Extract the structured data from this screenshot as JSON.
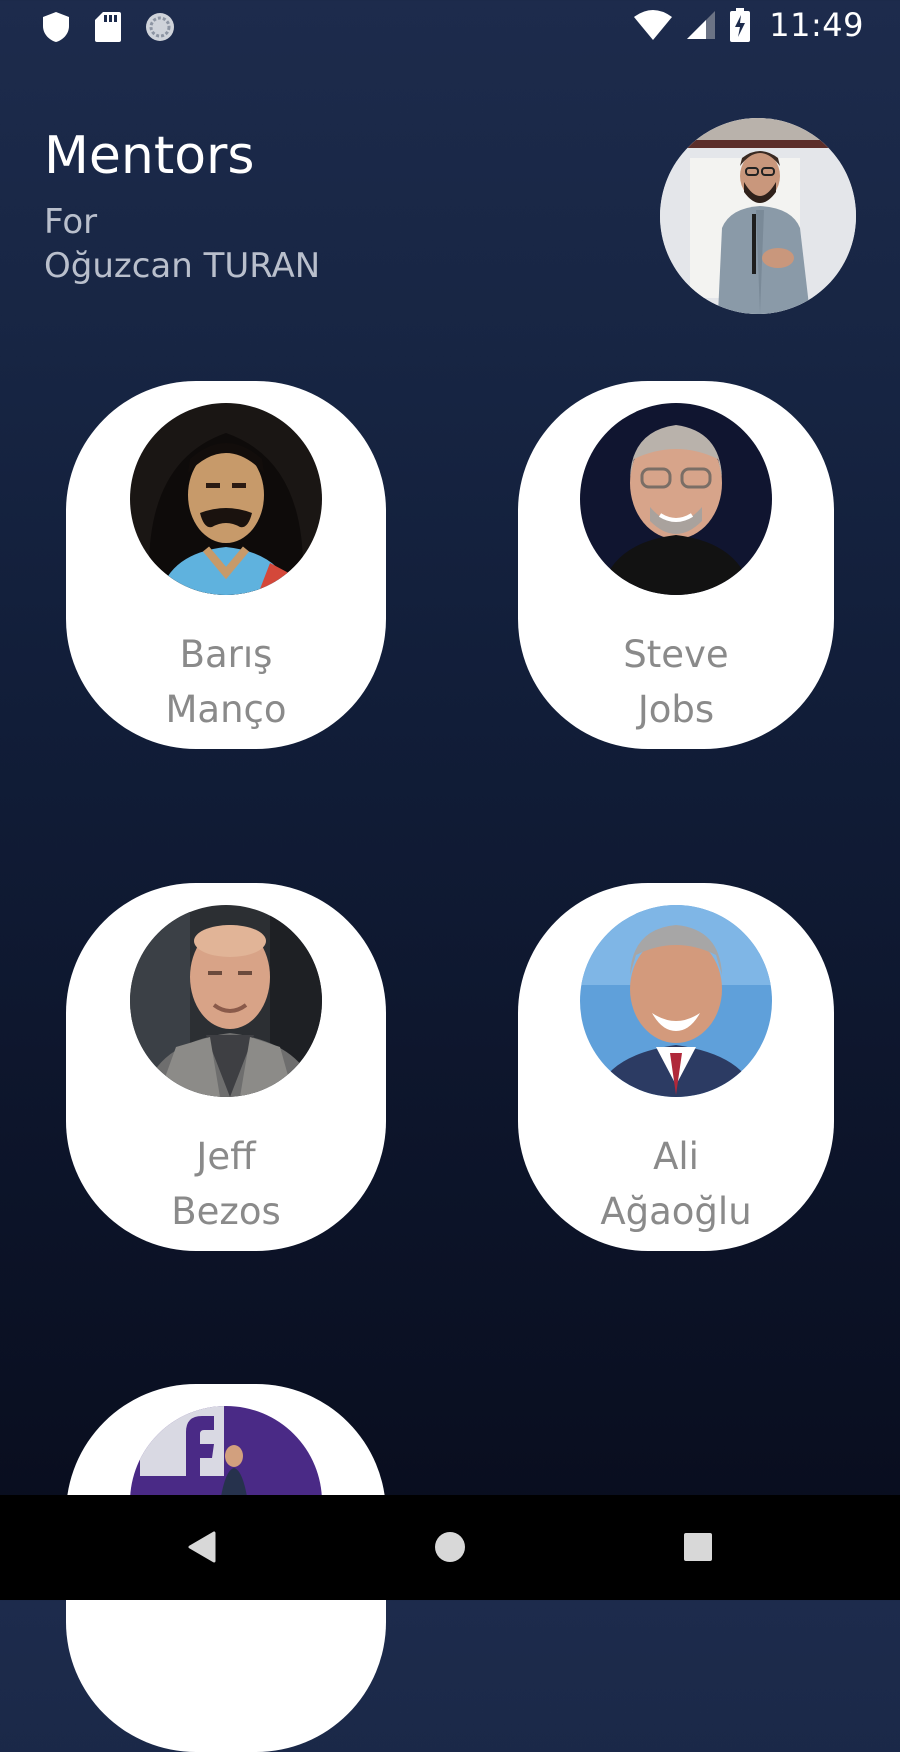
{
  "status_bar": {
    "time": "11:49",
    "icons": [
      "shield-icon",
      "sd-card-icon",
      "sync-icon",
      "wifi-icon",
      "cell-signal-icon",
      "battery-charging-icon"
    ]
  },
  "header": {
    "title": "Mentors",
    "subtitle_line1": "For",
    "subtitle_line2": "Oğuzcan TURAN"
  },
  "mentors": [
    {
      "first": "Barış",
      "last": "Manço"
    },
    {
      "first": "Steve",
      "last": "Jobs"
    },
    {
      "first": "Jeff",
      "last": "Bezos"
    },
    {
      "first": "Ali",
      "last": "Ağaoğlu"
    },
    {
      "first": "",
      "last": ""
    }
  ],
  "nav": {
    "icons": [
      "back-triangle-icon",
      "home-circle-icon",
      "recent-square-icon"
    ]
  },
  "colors": {
    "background_top": "#1d2b4c",
    "background_bottom": "#080c1c",
    "card": "#ffffff",
    "name_text": "#8a8a8a",
    "subtitle_text": "#b9bfcc"
  }
}
